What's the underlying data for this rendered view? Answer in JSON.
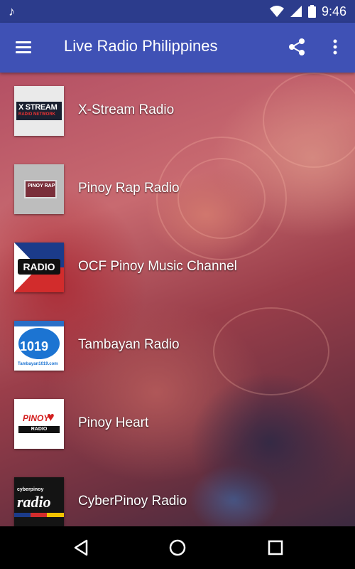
{
  "status_bar": {
    "time": "9:46",
    "icons": [
      "music-note-icon",
      "wifi-icon",
      "signal-icon",
      "battery-icon"
    ]
  },
  "app_bar": {
    "title": "Live Radio Philippines",
    "background_color": "#3f51b5",
    "status_color": "#2c3c8c"
  },
  "stations": [
    {
      "name": "X-Stream Radio",
      "logo_text": "X STREAM",
      "logo_subtext": "RADIO NETWORK"
    },
    {
      "name": "Pinoy Rap Radio",
      "logo_text": "PINOY RAP"
    },
    {
      "name": "OCF Pinoy Music Channel",
      "logo_text": "RADIO"
    },
    {
      "name": "Tambayan Radio",
      "logo_text": "1019",
      "logo_subtext": "Tambayan1019.com"
    },
    {
      "name": "Pinoy Heart",
      "logo_text": "PINOY",
      "logo_subtext": "RADIO"
    },
    {
      "name": "CyberPinoy Radio",
      "logo_text": "radio",
      "logo_subtext": "cyberpinoy"
    }
  ],
  "nav_bar": {
    "buttons": [
      "back-icon",
      "home-icon",
      "recents-icon"
    ]
  }
}
